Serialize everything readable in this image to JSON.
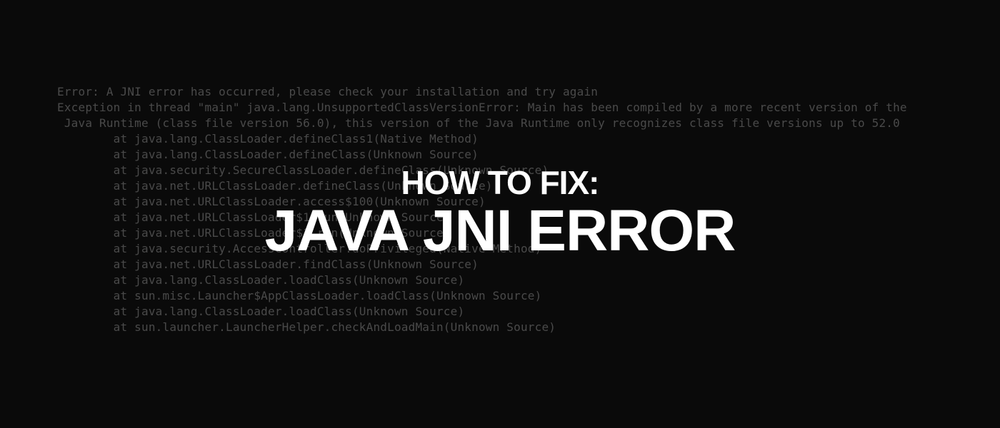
{
  "console": {
    "lines": [
      "Error: A JNI error has occurred, please check your installation and try again",
      "Exception in thread \"main\" java.lang.UnsupportedClassVersionError: Main has been compiled by a more recent version of the",
      " Java Runtime (class file version 56.0), this version of the Java Runtime only recognizes class file versions up to 52.0",
      "        at java.lang.ClassLoader.defineClass1(Native Method)",
      "        at java.lang.ClassLoader.defineClass(Unknown Source)",
      "        at java.security.SecureClassLoader.defineClass(Unknown Source)",
      "        at java.net.URLClassLoader.defineClass(Unknown Source)",
      "        at java.net.URLClassLoader.access$100(Unknown Source)",
      "        at java.net.URLClassLoader$1.run(Unknown Source)",
      "        at java.net.URLClassLoader$1.run(Unknown Source)",
      "        at java.security.AccessController.doPrivileged(Native Method)",
      "        at java.net.URLClassLoader.findClass(Unknown Source)",
      "        at java.lang.ClassLoader.loadClass(Unknown Source)",
      "        at sun.misc.Launcher$AppClassLoader.loadClass(Unknown Source)",
      "        at java.lang.ClassLoader.loadClass(Unknown Source)",
      "        at sun.launcher.LauncherHelper.checkAndLoadMain(Unknown Source)"
    ]
  },
  "overlay": {
    "line1": "HOW TO FIX:",
    "line2": "JAVA JNI ERROR"
  }
}
